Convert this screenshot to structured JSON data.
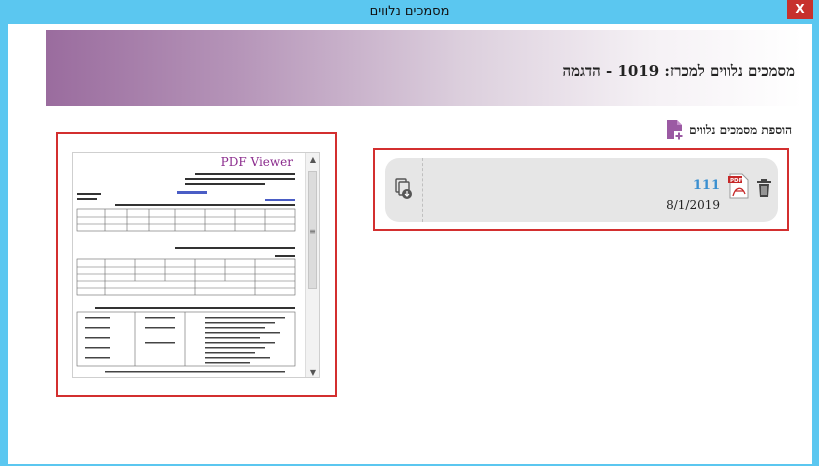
{
  "window": {
    "title": "מסמכים נלווים",
    "close_label": "X"
  },
  "banner": {
    "heading": "מסמכים נלווים למכרז: 1019 - הדגמה"
  },
  "add_documents": {
    "label": "הוספת מסמכים נלווים",
    "icon": "add-document-icon"
  },
  "viewer": {
    "title": "PDF Viewer"
  },
  "document": {
    "name": "111",
    "date": "8/1/2019",
    "file_icon": "pdf-icon",
    "delete_icon": "trash-icon",
    "download_icon": "download-document-icon"
  },
  "colors": {
    "accent": "#5bc7f0",
    "highlight_border": "#d32f2f",
    "link": "#3a8fd0",
    "viewer_title": "#8a2a8c"
  }
}
